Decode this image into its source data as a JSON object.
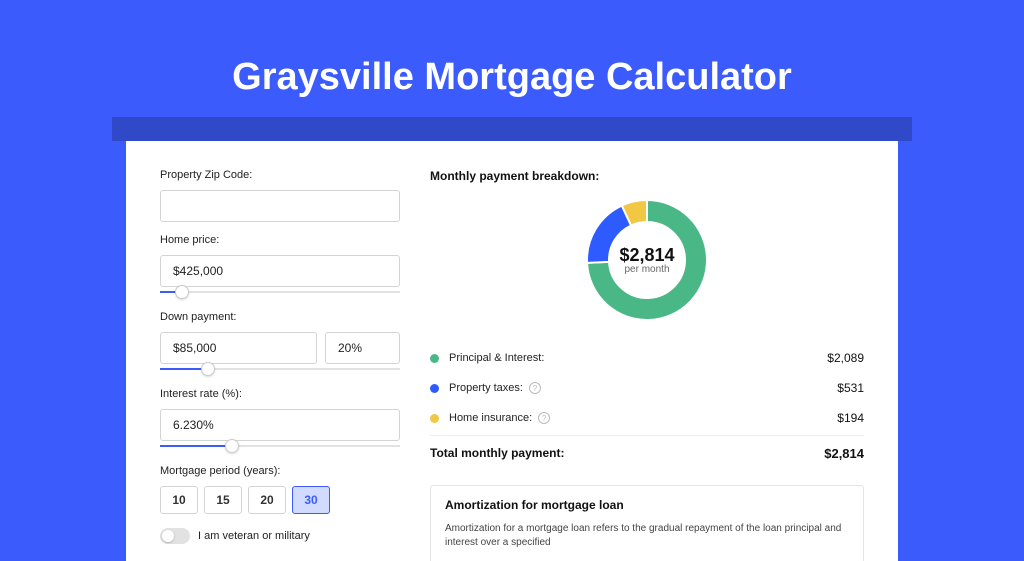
{
  "title": "Graysville Mortgage Calculator",
  "form": {
    "zip_label": "Property Zip Code:",
    "zip_value": "",
    "home_price_label": "Home price:",
    "home_price_value": "$425,000",
    "home_price_slider_pct": 9,
    "down_payment_label": "Down payment:",
    "down_payment_value": "$85,000",
    "down_payment_pct_value": "20%",
    "down_payment_slider_pct": 20,
    "interest_label": "Interest rate (%):",
    "interest_value": "6.230%",
    "interest_slider_pct": 30,
    "period_label": "Mortgage period (years):",
    "periods": [
      "10",
      "15",
      "20",
      "30"
    ],
    "period_active": "30",
    "veteran_label": "I am veteran or military"
  },
  "breakdown": {
    "title": "Monthly payment breakdown:",
    "center_amount": "$2,814",
    "center_sub": "per month",
    "items": [
      {
        "label": "Principal & Interest:",
        "value": "$2,089",
        "color": "#49B786",
        "info": false
      },
      {
        "label": "Property taxes:",
        "value": "$531",
        "color": "#2D5BFF",
        "info": true
      },
      {
        "label": "Home insurance:",
        "value": "$194",
        "color": "#F2C744",
        "info": true
      }
    ],
    "total_label": "Total monthly payment:",
    "total_value": "$2,814"
  },
  "chart_data": {
    "type": "pie",
    "title": "Monthly payment breakdown",
    "series": [
      {
        "name": "Principal & Interest",
        "value": 2089,
        "color": "#49B786"
      },
      {
        "name": "Property taxes",
        "value": 531,
        "color": "#2D5BFF"
      },
      {
        "name": "Home insurance",
        "value": 194,
        "color": "#F2C744"
      }
    ],
    "total": 2814,
    "unit": "USD per month"
  },
  "amort": {
    "title": "Amortization for mortgage loan",
    "text": "Amortization for a mortgage loan refers to the gradual repayment of the loan principal and interest over a specified"
  }
}
